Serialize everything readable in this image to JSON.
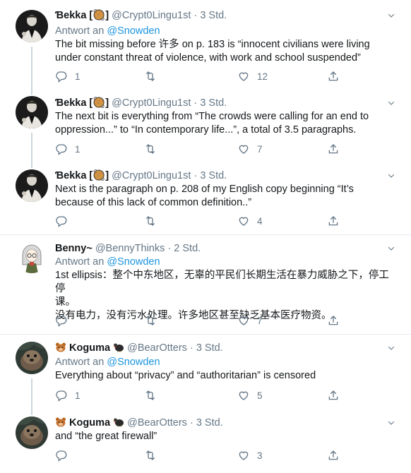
{
  "tweets": [
    {
      "name": "Ɓekka [🥘]",
      "handle": "@Crypt0Lingu1st",
      "dot": "·",
      "time": "3 Std.",
      "reply_label": "Antwort an",
      "reply_to": "@Snowden",
      "text": "The bit missing before 许多 on p. 183 is “innocent civilians were living under constant threat of violence, with work and school suspended”",
      "replies": "1",
      "retweets": "",
      "likes": "12"
    },
    {
      "name": "Ɓekka [🥘]",
      "handle": "@Crypt0Lingu1st",
      "dot": "·",
      "time": "3 Std.",
      "text": "The next bit is everything from “The crowds were calling for an end to oppression...” to “In contemporary life...”, a total of 3.5 paragraphs.",
      "replies": "1",
      "retweets": "",
      "likes": "7"
    },
    {
      "name": "Ɓekka [🥘]",
      "handle": "@Crypt0Lingu1st",
      "dot": "·",
      "time": "3 Std.",
      "text": "Next is the paragraph on p. 208 of my English copy beginning “It’s because of this lack of common definition..”",
      "replies": "",
      "retweets": "",
      "likes": "4"
    },
    {
      "name": "Benny~",
      "handle": "@BennyThinks",
      "dot": "·",
      "time": "2 Std.",
      "reply_label": "Antwort an",
      "reply_to": "@Snowden",
      "text_lines": [
        "1st ellipsis：整个中东地区，无辜的平民们长期生活在暴力威胁之下，停工停",
        "课。",
        "没有电力，没有污水处理。许多地区甚至缺乏基本医疗物资。"
      ],
      "replies": "",
      "retweets": "",
      "likes": "7"
    },
    {
      "name": "Koguma",
      "handle": "@BearOtters",
      "dot": "·",
      "time": "3 Std.",
      "reply_label": "Antwort an",
      "reply_to": "@Snowden",
      "text": "Everything about “privacy” and “authoritarian” is censored",
      "replies": "1",
      "retweets": "",
      "likes": "5"
    },
    {
      "name": "Koguma",
      "handle": "@BearOtters",
      "dot": "·",
      "time": "3 Std.",
      "text": "and “the great firewall”",
      "replies": "",
      "retweets": "",
      "likes": "3"
    }
  ],
  "icons": {
    "reply": "reply-icon",
    "retweet": "retweet-icon",
    "like": "heart-icon",
    "share": "share-icon",
    "caret": "chevron-down-icon"
  },
  "colors": {
    "link": "#1b95e0",
    "muted": "#657786",
    "text": "#14171a",
    "divider": "#e6ecf0",
    "thread": "#ccd6dd"
  }
}
